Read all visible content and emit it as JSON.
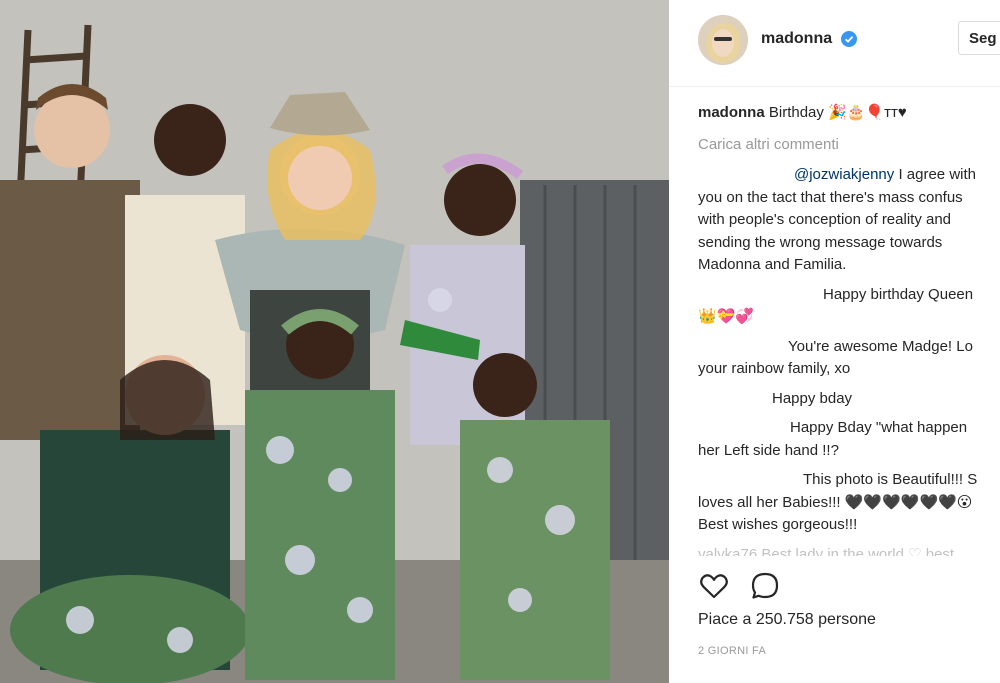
{
  "post": {
    "username": "madonna",
    "follow_label": "Seg",
    "caption_user": "madonna",
    "caption_text": "Birthday 🎉🎂🎈тт♥",
    "load_more_label": "Carica altri commenti",
    "likes_text": "Piace a 250.758 persone",
    "time_text": "2 GIORNI FA"
  },
  "comments": [
    {
      "mention": "@jozwiakjenny",
      "lines": [
        "I agree with",
        "you on the tact that there's mass confus",
        "with people's conception of reality and",
        "sending the wrong message towards",
        "Madonna and Familia."
      ]
    },
    {
      "lines": [
        "Happy birthday Queen",
        "👑💝💞"
      ]
    },
    {
      "lines": [
        "You're awesome Madge! Lo",
        "your rainbow family, xo"
      ]
    },
    {
      "lines": [
        "Happy bday"
      ]
    },
    {
      "lines": [
        "Happy Bday \"what happen",
        "her Left side hand !!?"
      ]
    },
    {
      "lines": [
        "This photo is Beautiful!!! S",
        "loves all her Babies!!! 🖤🖤🖤🖤🖤🖤😮",
        "Best wishes gorgeous!!!"
      ]
    },
    {
      "lines": [
        "valyka76 Best lady in the world ♡ best"
      ]
    }
  ],
  "icons": {
    "verified": "verified-badge-icon",
    "like": "heart-icon",
    "comment": "comment-bubble-icon"
  },
  "colors": {
    "verified": "#3897f0",
    "mention": "#003569",
    "muted": "#999999",
    "border": "#efefef"
  }
}
